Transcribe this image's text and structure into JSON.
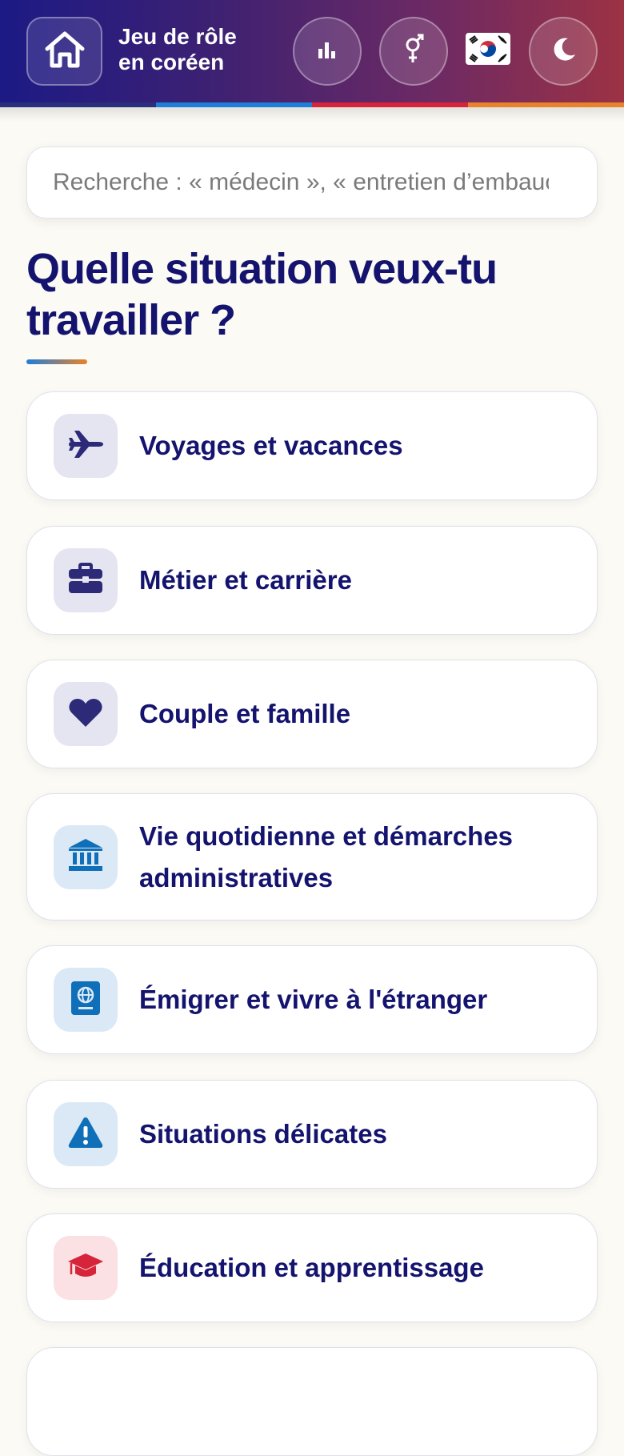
{
  "header": {
    "title_line1": "Jeu de rôle",
    "title_line2": "en coréen",
    "flag": "🇰🇷",
    "buttons": {
      "home": "home-icon",
      "stats": "bar-chart-icon",
      "gender": "gender-icon",
      "theme": "moon-icon"
    }
  },
  "search": {
    "placeholder": "Recherche : « médecin », « entretien d’embauche »..."
  },
  "main": {
    "heading": "Quelle situation veux-tu travailler ?"
  },
  "categories": [
    {
      "label": "Voyages et vacances",
      "icon": "airplane-icon",
      "tone": "purple"
    },
    {
      "label": "Métier et carrière",
      "icon": "briefcase-icon",
      "tone": "purple"
    },
    {
      "label": "Couple et famille",
      "icon": "heart-icon",
      "tone": "purple"
    },
    {
      "label": "Vie quotidienne et démarches administratives",
      "icon": "bank-icon",
      "tone": "blue"
    },
    {
      "label": "Émigrer et vivre à l'étranger",
      "icon": "passport-icon",
      "tone": "blue"
    },
    {
      "label": "Situations délicates",
      "icon": "warning-icon",
      "tone": "blue"
    },
    {
      "label": "Éducation et apprentissage",
      "icon": "graduation-cap-icon",
      "tone": "pink"
    }
  ],
  "colors": {
    "heading": "#14136e",
    "accent_blue": "#1e7ed8",
    "accent_red": "#d6253a",
    "accent_orange": "#e8822c"
  }
}
